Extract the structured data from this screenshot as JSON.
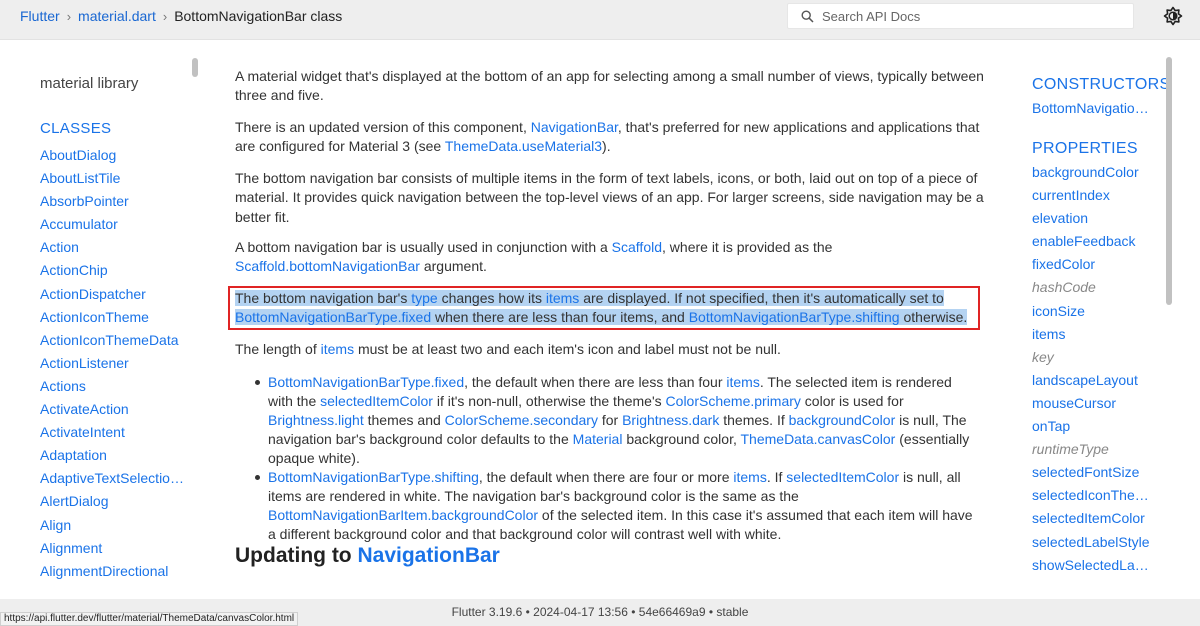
{
  "breadcrumb": {
    "items": [
      "Flutter",
      "material.dart"
    ],
    "current": "BottomNavigationBar class"
  },
  "search": {
    "placeholder": "Search API Docs"
  },
  "icons": {
    "search": "search-icon",
    "theme": "theme-toggle-icon"
  },
  "left_sidebar": {
    "library_title": "material library",
    "classes_heading": "CLASSES",
    "classes": [
      "AboutDialog",
      "AboutListTile",
      "AbsorbPointer",
      "Accumulator",
      "Action",
      "ActionChip",
      "ActionDispatcher",
      "ActionIconTheme",
      "ActionIconThemeData",
      "ActionListener",
      "Actions",
      "ActivateAction",
      "ActivateIntent",
      "Adaptation",
      "AdaptiveTextSelection…",
      "AlertDialog",
      "Align",
      "Alignment",
      "AlignmentDirectional"
    ]
  },
  "main": {
    "p1": "A material widget that's displayed at the bottom of an app for selecting among a small number of views, typically between three and five.",
    "p2": {
      "a": "There is an updated version of this component, ",
      "link1": "NavigationBar",
      "b": ", that's preferred for new applications and applications that are configured for Material 3 (see ",
      "link2": "ThemeData.useMaterial3",
      "c": ")."
    },
    "p3": "The bottom navigation bar consists of multiple items in the form of text labels, icons, or both, laid out on top of a piece of material. It provides quick navigation between the top-level views of an app. For larger screens, side navigation may be a better fit.",
    "p4": {
      "a": "A bottom navigation bar is usually used in conjunction with a ",
      "link1": "Scaffold",
      "b": ", where it is provided as the ",
      "link2": "Scaffold.bottomNavigationBar",
      "c": " argument."
    },
    "p5": {
      "a": "The bottom navigation bar's ",
      "link1": "type",
      "b": " changes how its ",
      "link2": "items",
      "c": " are displayed. If not specified, then it's automatically set to ",
      "link3": "BottomNavigationBarType.fixed",
      "d": " when there are less than four items, and ",
      "link4": "BottomNavigationBarType.shifting",
      "e": " otherwise."
    },
    "p6": {
      "a": "The length of ",
      "link1": "items",
      "b": " must be at least two and each item's icon and label must not be null."
    },
    "bullet1": {
      "link1": "BottomNavigationBarType.fixed",
      "a": ", the default when there are less than four ",
      "link2": "items",
      "b": ". The selected item is rendered with the ",
      "link3": "selectedItemColor",
      "c": " if it's non-null, otherwise the theme's ",
      "link4": "ColorScheme.primary",
      "d": " color is used for ",
      "link5": "Brightness.light",
      "e": " themes and ",
      "link6": "ColorScheme.secondary",
      "f": " for ",
      "link7": "Brightness.dark",
      "g": " themes. If ",
      "link8": "backgroundColor",
      "h": " is null, The navigation bar's background color defaults to the ",
      "link9": "Material",
      "i": " background color, ",
      "link10": "ThemeData.canvasColor",
      "j": " (essentially opaque white)."
    },
    "bullet2": {
      "link1": "BottomNavigationBarType.shifting",
      "a": ", the default when there are four or more ",
      "link2": "items",
      "b": ". If ",
      "link3": "selectedItemColor",
      "c": " is null, all items are rendered in white. The navigation bar's background color is the same as the ",
      "link4": "BottomNavigationBarItem.backgroundColor",
      "d": " of the selected item. In this case it's assumed that each item will have a different background color and that background color will contrast well with white."
    },
    "heading": {
      "a": "Updating to ",
      "link": "NavigationBar"
    }
  },
  "right_sidebar": {
    "constructors_heading": "CONSTRUCTORS",
    "constructors": [
      "BottomNavigatio…"
    ],
    "properties_heading": "PROPERTIES",
    "properties": [
      "backgroundColor",
      "currentIndex",
      "elevation",
      "enableFeedback",
      "fixedColor",
      "hashCode",
      "iconSize",
      "items",
      "key",
      "landscapeLayout",
      "mouseCursor",
      "onTap",
      "runtimeType",
      "selectedFontSize",
      "selectedIconThe…",
      "selectedItemColor",
      "selectedLabelStyle",
      "showSelectedLab…"
    ],
    "inherited": [
      "hashCode",
      "key",
      "runtimeType"
    ]
  },
  "footer": {
    "text": "Flutter 3.19.6 • 2024-04-17 13:56 • 54e66469a9 • stable"
  },
  "status_url": "https://api.flutter.dev/flutter/material/ThemeData/canvasColor.html",
  "colors": {
    "link": "#1a73e8",
    "header_bg": "#eeeeee",
    "highlight_box": "#e02424",
    "selection": "#b4d3f2"
  }
}
